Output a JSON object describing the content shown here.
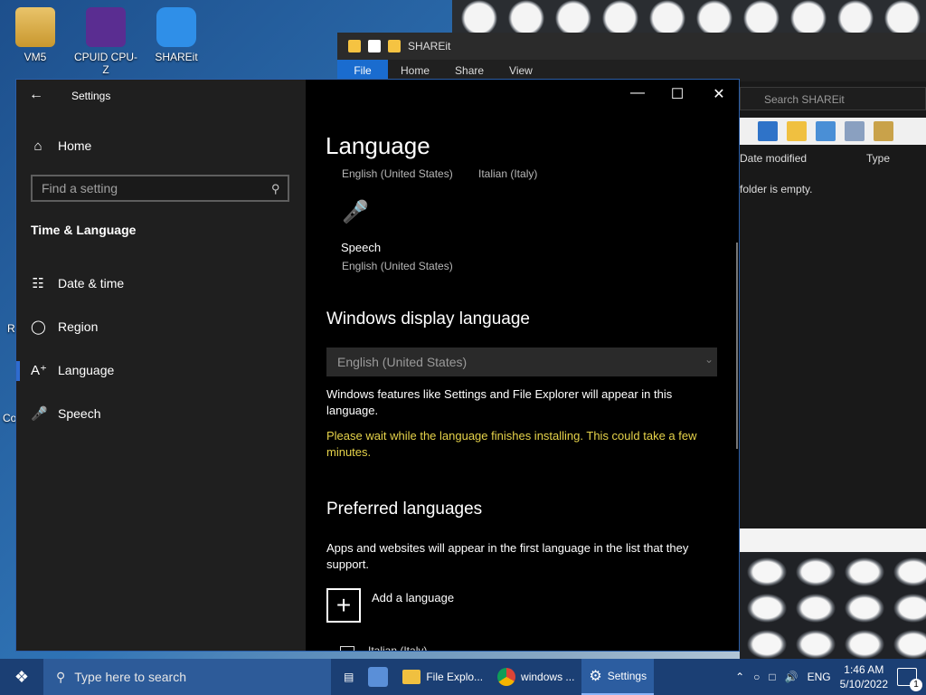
{
  "desktop": {
    "icons": [
      {
        "label": "VM5"
      },
      {
        "label": "CPUID CPU-Z"
      },
      {
        "label": "SHAREit"
      }
    ],
    "edge_letters": [
      "R",
      "Co"
    ]
  },
  "explorer": {
    "title": "SHAREit",
    "tabs": [
      "File",
      "Home",
      "Share",
      "View"
    ],
    "search_placeholder": "Search SHAREit",
    "col_date": "Date modified",
    "col_type": "Type",
    "empty_text": "folder is empty."
  },
  "settings": {
    "app_title": "Settings",
    "home_label": "Home",
    "search_placeholder": "Find a setting",
    "section_title": "Time & Language",
    "nav": [
      {
        "label": "Date & time",
        "icon": "calendar-clock-icon"
      },
      {
        "label": "Region",
        "icon": "globe-icon"
      },
      {
        "label": "Language",
        "icon": "language-icon"
      },
      {
        "label": "Speech",
        "icon": "microphone-icon"
      }
    ],
    "selected_nav": "Language",
    "page_title": "Language",
    "quick_langs": [
      "English (United States)",
      "Italian (Italy)"
    ],
    "speech_label": "Speech",
    "speech_sub": "English (United States)",
    "display_heading": "Windows display language",
    "display_value": "English (United States)",
    "display_desc": "Windows features like Settings and File Explorer will appear in this language.",
    "wait_msg": "Please wait while the language finishes installing. This could take a few minutes.",
    "preferred_heading": "Preferred languages",
    "preferred_desc": "Apps and websites will appear in the first language in the list that they support.",
    "add_label": "Add a language",
    "first_lang": "Italian (Italy)",
    "accent": "#2f6cd0",
    "warn_color": "#e6d34a"
  },
  "taskbar": {
    "search_placeholder": "Type here to search",
    "apps": [
      {
        "label": "File Explo..."
      },
      {
        "label": "windows ..."
      },
      {
        "label": "Settings"
      }
    ],
    "lang": "ENG",
    "time": "1:46 AM",
    "date": "5/10/2022",
    "notifications": "1"
  }
}
